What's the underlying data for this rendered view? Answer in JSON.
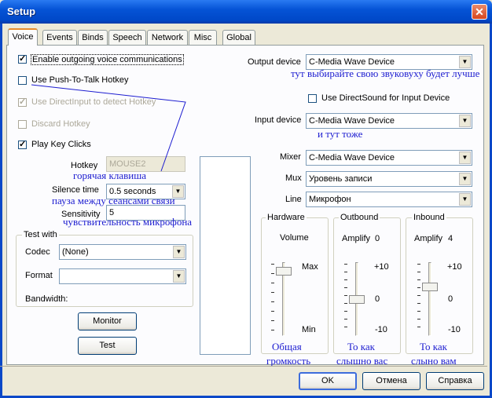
{
  "window": {
    "title": "Setup",
    "close_icon": "close-icon"
  },
  "tabs": [
    {
      "label": "Voice",
      "active": true
    },
    {
      "label": "Events"
    },
    {
      "label": "Binds"
    },
    {
      "label": "Speech"
    },
    {
      "label": "Network"
    },
    {
      "label": "Misc"
    },
    {
      "label": "Global"
    }
  ],
  "left": {
    "enable_outgoing": {
      "label": "Enable outgoing voice communications",
      "checked": true
    },
    "push_to_talk": {
      "label": "Use Push-To-Talk Hotkey",
      "checked": false
    },
    "directinput": {
      "label": "Use DirectInput to detect Hotkey",
      "checked": true,
      "disabled": true
    },
    "discard_hotkey": {
      "label": "Discard Hotkey",
      "checked": false,
      "disabled": true
    },
    "play_key_clicks": {
      "label": "Play Key Clicks",
      "checked": true
    },
    "hotkey": {
      "label": "Hotkey",
      "value": "MOUSE2"
    },
    "silence_time": {
      "label": "Silence time",
      "value": "0.5 seconds"
    },
    "sensitivity": {
      "label": "Sensitivity",
      "value": "5"
    },
    "test_with": {
      "title": "Test with",
      "codec_label": "Codec",
      "codec_value": "(None)",
      "format_label": "Format",
      "format_value": "",
      "bandwidth_label": "Bandwidth:"
    },
    "monitor_button": "Monitor",
    "test_button": "Test"
  },
  "right": {
    "output_device": {
      "label": "Output device",
      "value": "C-Media Wave Device"
    },
    "directsound": {
      "label": "Use DirectSound for Input Device",
      "checked": false
    },
    "input_device": {
      "label": "Input device",
      "value": "C-Media Wave Device"
    },
    "mixer": {
      "label": "Mixer",
      "value": "C-Media Wave Device"
    },
    "mux": {
      "label": "Mux",
      "value": "Уровень записи"
    },
    "line": {
      "label": "Line",
      "value": "Микрофон"
    },
    "hardware": {
      "title": "Hardware",
      "volume_label": "Volume",
      "max_label": "Max",
      "min_label": "Min"
    },
    "outbound": {
      "title": "Outbound",
      "amplify_label": "Amplify",
      "amplify_value": "0",
      "plus10": "+10",
      "zero": "0",
      "minus10": "-10"
    },
    "inbound": {
      "title": "Inbound",
      "amplify_label": "Amplify",
      "amplify_value": "4",
      "plus10": "+10",
      "zero": "0",
      "minus10": "-10"
    }
  },
  "annotations": {
    "output": "тут выбирайте свою звуковуху будет лучше",
    "input": "и тут тоже",
    "hotkey": "горячая клавиша",
    "silence": "пауза между сеансами связи",
    "sensitivity": "чувствительность микрофона",
    "hardware_1": "Общая",
    "hardware_2": "громкость",
    "outbound_1": "То как",
    "outbound_2": "слышно вас",
    "inbound_1": "То как",
    "inbound_2": "слыно вам"
  },
  "footer": {
    "ok": "OK",
    "cancel": "Отмена",
    "help": "Справка"
  },
  "colors": {
    "title_bar": "#0553d6",
    "annotation": "#1c1cd0",
    "tab_highlight": "#e68b2c"
  }
}
